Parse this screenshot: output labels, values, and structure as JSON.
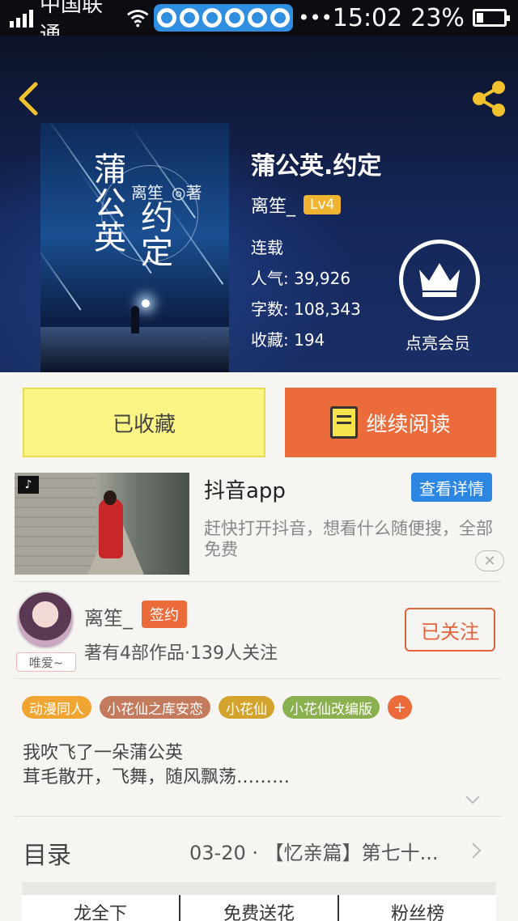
{
  "status_bar": {
    "carrier": "中国联通",
    "time": "15:02",
    "battery_pct": "23%",
    "dots": "•••"
  },
  "book": {
    "title": "蒲公英.约定",
    "author": "离笙_",
    "level": "Lv4",
    "status": "连载",
    "popularity_label": "人气:",
    "popularity": "39,926",
    "words_label": "字数:",
    "words": "108,343",
    "favorites_label": "收藏:",
    "favorites": "194",
    "cover_title_right": "蒲公英",
    "cover_title_left": "约定",
    "cover_author": "离笙_◎著"
  },
  "vip": {
    "label": "点亮会员"
  },
  "actions": {
    "favorited": "已收藏",
    "continue_read": "继续阅读"
  },
  "ad": {
    "title": "抖音app",
    "detail_button": "查看详情",
    "description": "赶快打开抖音，想看什么随便搜，全部免费",
    "close": "✕"
  },
  "author_card": {
    "name": "离笙_",
    "badge": "签约",
    "works": "著有4部作品·139人关注",
    "avatar_tag": "唯爱~",
    "follow_button": "已关注"
  },
  "tags": [
    {
      "label": "动漫同人",
      "color": "#f0a532"
    },
    {
      "label": "小花仙之库安恋",
      "color": "#c47a5c"
    },
    {
      "label": "小花仙",
      "color": "#d4a32e"
    },
    {
      "label": "小花仙改编版",
      "color": "#8bb04f"
    }
  ],
  "tag_more": "+",
  "intro": {
    "line1": "我吹飞了一朵蒲公英",
    "line2": "茸毛散开，飞舞，随风飘荡………"
  },
  "toc": {
    "label": "目录",
    "latest": "03-20 · 【忆亲篇】第七十..."
  },
  "bottom_tabs": [
    "龙全下",
    "免费送花",
    "粉丝榜"
  ]
}
